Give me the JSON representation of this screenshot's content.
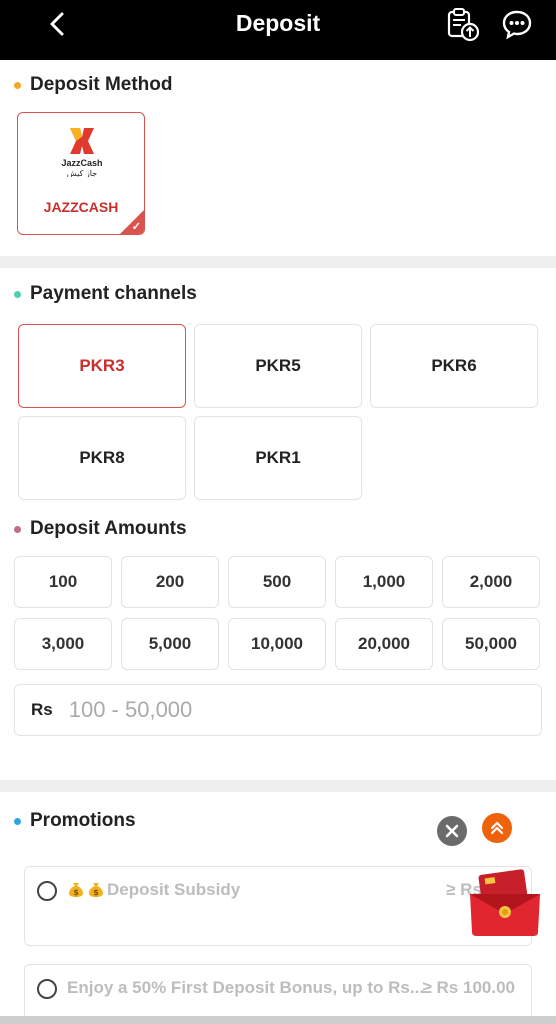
{
  "header": {
    "title": "Deposit",
    "back_icon": "chevron-left-icon",
    "history_icon": "clipboard-upload-icon",
    "support_icon": "chat-support-icon"
  },
  "deposit_method": {
    "title": "Deposit Method",
    "dot_color": "#f5a623",
    "methods": [
      {
        "logo_text": "JazzCash",
        "logo_urdu": "جاز کیش",
        "label": "JAZZCASH",
        "selected": true
      }
    ]
  },
  "payment_channels": {
    "title": "Payment channels",
    "dot_color": "#4dd0b1",
    "channels": [
      "PKR3",
      "PKR5",
      "PKR6",
      "PKR8",
      "PKR1"
    ],
    "selected": "PKR3"
  },
  "deposit_amounts": {
    "title": "Deposit Amounts",
    "dot_color": "#c06b8b",
    "amounts": [
      "100",
      "200",
      "500",
      "1,000",
      "2,000",
      "3,000",
      "5,000",
      "10,000",
      "20,000",
      "50,000"
    ],
    "currency_label": "Rs",
    "input_placeholder": "100 - 50,000"
  },
  "promotions": {
    "title": "Promotions",
    "dot_color": "#29a9e0",
    "close_icon": "close-icon",
    "collapse_icon": "chevron-double-up-icon",
    "accent": "#f0620a",
    "items": [
      {
        "title": "Deposit Subsidy",
        "min_amount": "≥ Rs 100"
      },
      {
        "title": "Enjoy a 50% First Deposit Bonus, up to Rs...",
        "min_amount": "≥ Rs 100.00"
      }
    ]
  },
  "colors": {
    "active_red": "#d9534f",
    "header_bg": "#000000"
  }
}
